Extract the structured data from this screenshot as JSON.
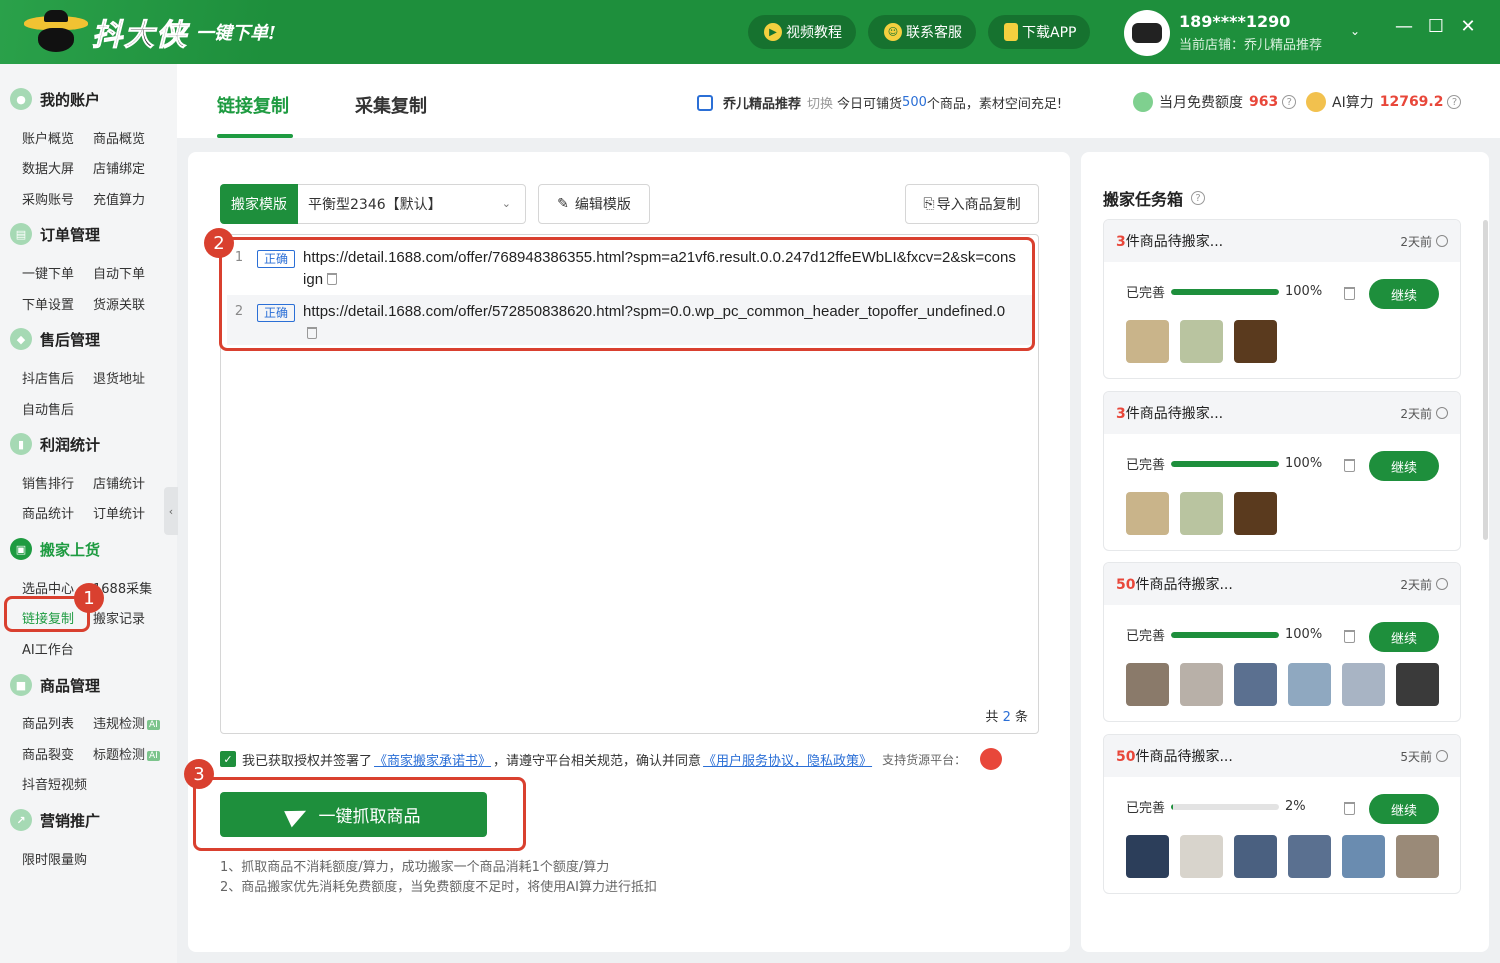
{
  "header": {
    "logo_text": "抖大侠",
    "slogan": "一键下单!",
    "buttons": [
      {
        "label": "视频教程",
        "icon": "play-icon"
      },
      {
        "label": "联系客服",
        "icon": "smile-icon"
      },
      {
        "label": "下载APP",
        "icon": "phone-icon"
      }
    ],
    "user": {
      "phone": "189****1290",
      "shop_line": "当前店铺：乔儿精品推荐"
    },
    "window": {
      "min": "—",
      "max": "☐",
      "close": "✕"
    }
  },
  "sidebar": {
    "groups": [
      {
        "label": "我的账户",
        "items": [
          "账户概览",
          "商品概览",
          "数据大屏",
          "店铺绑定",
          "采购账号",
          "充值算力"
        ]
      },
      {
        "label": "订单管理",
        "items": [
          "一键下单",
          "自动下单",
          "下单设置",
          "货源关联"
        ]
      },
      {
        "label": "售后管理",
        "items": [
          "抖店售后",
          "退货地址",
          "自动售后"
        ]
      },
      {
        "label": "利润统计",
        "items": [
          "销售排行",
          "店铺统计",
          "商品统计",
          "订单统计"
        ]
      },
      {
        "label": "搬家上货",
        "items": [
          "选品中心",
          "1688采集",
          "链接复制",
          "搬家记录",
          "AI工作台"
        ]
      },
      {
        "label": "商品管理",
        "items": [
          "商品列表",
          "违规检测",
          "商品裂变",
          "标题检测",
          "抖音短视频"
        ]
      },
      {
        "label": "营销推广",
        "items": [
          "限时限量购"
        ]
      }
    ],
    "ai_tag": "AI",
    "collapse": "‹"
  },
  "annotations": [
    "1",
    "2",
    "3"
  ],
  "tabs": [
    "链接复制",
    "采集复制"
  ],
  "notice": {
    "shop": "乔儿精品推荐",
    "switch": "切换",
    "pre": "今日可铺货",
    "count": "500",
    "post": "个商品，素材空间充足!"
  },
  "quota": {
    "free_label": "当月免费额度",
    "free_value": "963",
    "ai_label": "AI算力",
    "ai_value": "12769.2",
    "help": "?"
  },
  "main": {
    "template_label": "搬家模版",
    "template_value": "平衡型2346【默认】",
    "edit_label": "编辑模版",
    "import_label": "导入商品复制",
    "links": [
      {
        "num": "1",
        "status": "正确",
        "url": "https://detail.1688.com/offer/768948386355.html?spm=a21vf6.result.0.0.247d12ffeEWbLI&fxcv=2&sk=consign"
      },
      {
        "num": "2",
        "status": "正确",
        "url": "https://detail.1688.com/offer/572850838620.html?spm=0.0.wp_pc_common_header_topoffer_undefined.0"
      }
    ],
    "total_pre": "共",
    "total_count": "2",
    "total_post": "条",
    "agree": {
      "pre": "我已获取授权并签署了",
      "link1": "《商家搬家承诺书》",
      "mid": "，请遵守平台相关规范，确认并同意",
      "link2": "《用户服务协议，隐私政策》",
      "platform": "支持货源平台："
    },
    "grab_label": "一键抓取商品",
    "tips": [
      "1、抓取商品不消耗额度/算力，成功搬家一个商品消耗1个额度/算力",
      "2、商品搬家优先消耗免费额度，当免费额度不足时，将使用AI算力进行抵扣"
    ]
  },
  "tasks": {
    "title": "搬家任务箱",
    "help": "?",
    "done_label": "已完善",
    "continue_label": "继续",
    "items": [
      {
        "count": "3",
        "suffix": "件商品待搬家...",
        "time": "2天前",
        "percent": "100%",
        "fill": 1.0,
        "thumbs": [
          "#c9b48a",
          "#b9c4a0",
          "#5a3a1e"
        ]
      },
      {
        "count": "3",
        "suffix": "件商品待搬家...",
        "time": "2天前",
        "percent": "100%",
        "fill": 1.0,
        "thumbs": [
          "#c9b48a",
          "#b9c4a0",
          "#5a3a1e"
        ]
      },
      {
        "count": "50",
        "suffix": "件商品待搬家...",
        "time": "2天前",
        "percent": "100%",
        "fill": 1.0,
        "thumbs": [
          "#8a7a6a",
          "#b8b0a8",
          "#5b7090",
          "#8fa8c0",
          "#a8b4c4",
          "#3a3a3a"
        ]
      },
      {
        "count": "50",
        "suffix": "件商品待搬家...",
        "time": "5天前",
        "percent": "2%",
        "fill": 0.02,
        "thumbs": [
          "#2c3e5a",
          "#d8d4cc",
          "#4a6080",
          "#5a7090",
          "#6a8cb0",
          "#9a8a78"
        ]
      }
    ]
  },
  "colors": {
    "brand": "#1e8f3c",
    "accent_red": "#d9402f",
    "link_blue": "#2b6fd6"
  }
}
